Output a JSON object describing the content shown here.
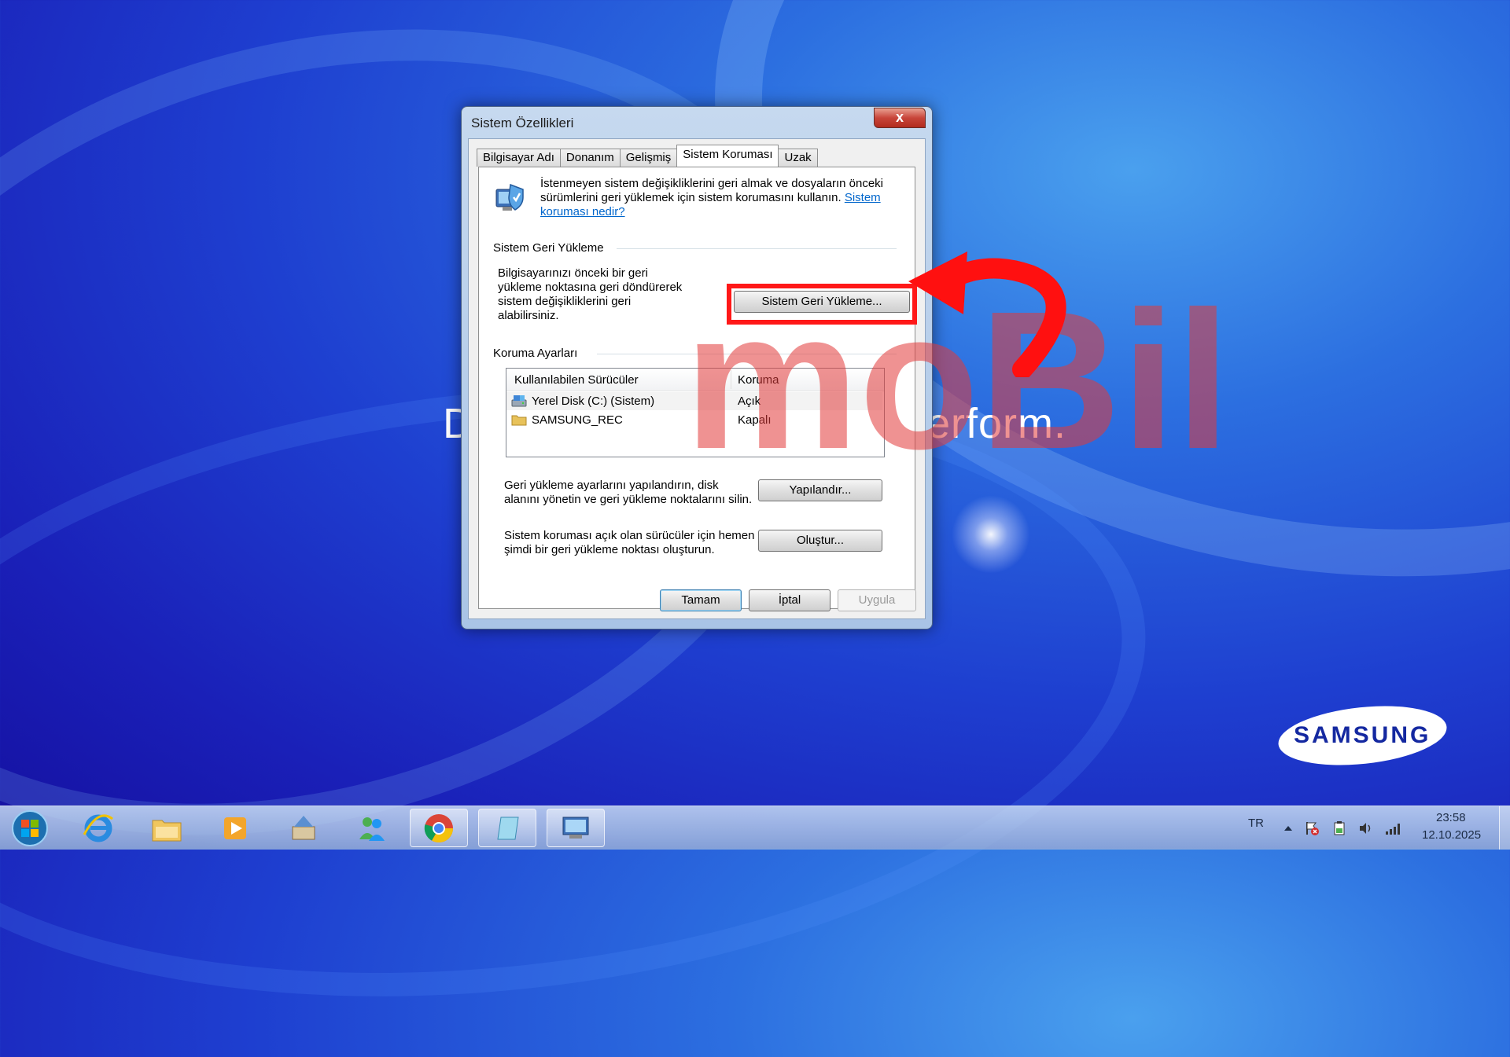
{
  "desktop": {
    "tagline_left": "D",
    "tagline_right": "erform.",
    "brand_logo": "SAMSUNG",
    "watermark": "moBil"
  },
  "dialog": {
    "title": "Sistem Özellikleri",
    "close_label": "x",
    "tabs": [
      {
        "label": "Bilgisayar Adı"
      },
      {
        "label": "Donanım"
      },
      {
        "label": "Gelişmiş"
      },
      {
        "label": "Sistem Koruması"
      },
      {
        "label": "Uzak"
      }
    ],
    "active_tab": "Sistem Koruması",
    "intro_text": "İstenmeyen sistem değişikliklerini geri almak ve dosyaların önceki sürümlerini geri yüklemek için sistem korumasını kullanın.",
    "intro_link": "Sistem koruması nedir?",
    "restore_group": {
      "title": "Sistem Geri Yükleme",
      "description": "Bilgisayarınızı önceki bir geri yükleme noktasına geri döndürerek sistem değişikliklerini geri alabilirsiniz.",
      "button": "Sistem Geri Yükleme..."
    },
    "protection_group": {
      "title": "Koruma Ayarları",
      "columns": [
        "Kullanılabilen Sürücüler",
        "Koruma"
      ],
      "rows": [
        {
          "name": "Yerel Disk (C:) (Sistem)",
          "status": "Açık",
          "icon": "system-drive-icon"
        },
        {
          "name": "SAMSUNG_REC",
          "status": "Kapalı",
          "icon": "folder-drive-icon"
        }
      ],
      "configure_text": "Geri yükleme ayarlarını yapılandırın, disk alanını yönetin ve geri yükleme noktalarını silin.",
      "configure_button": "Yapılandır...",
      "create_text": "Sistem koruması açık olan sürücüler için hemen şimdi bir geri yükleme noktası oluşturun.",
      "create_button": "Oluştur..."
    },
    "buttons": {
      "ok": "Tamam",
      "cancel": "İptal",
      "apply": "Uygula"
    }
  },
  "taskbar": {
    "apps": [
      {
        "icon": "internet-explorer-icon"
      },
      {
        "icon": "file-explorer-icon"
      },
      {
        "icon": "media-player-icon"
      },
      {
        "icon": "sampler-app-icon"
      },
      {
        "icon": "people-app-icon"
      },
      {
        "icon": "chrome-icon"
      },
      {
        "icon": "notepad-window-icon"
      },
      {
        "icon": "system-properties-icon"
      }
    ],
    "language": "TR",
    "time": "23:58",
    "date": "12.10.2025"
  },
  "colors": {
    "highlight": "#ff1818",
    "arrow": "#ff1010",
    "link": "#0066cc"
  }
}
